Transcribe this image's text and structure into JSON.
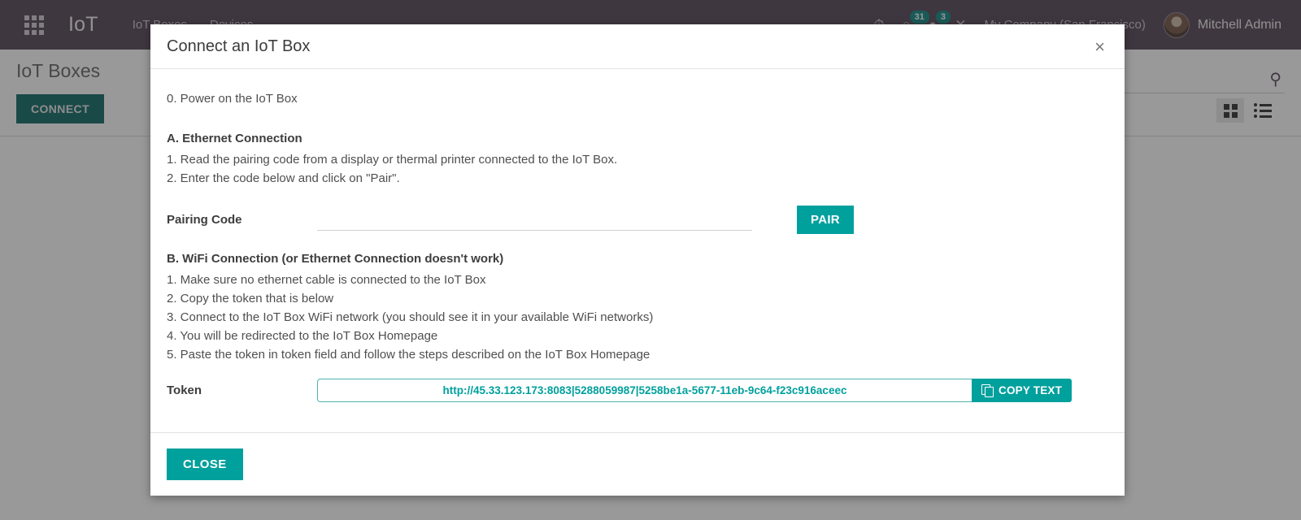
{
  "navbar": {
    "apps_icon": "apps-grid-icon",
    "brand": "IoT",
    "menu": [
      {
        "label": "IoT Boxes"
      },
      {
        "label": "Devices"
      }
    ],
    "activity_icon": "clock-icon",
    "calendar_icon": "calendar-icon",
    "calendar_count": "31",
    "messages_icon": "chat-icon",
    "messages_count": "3",
    "debug_icon": "bug-icon",
    "company": "My Company (San Francisco)",
    "user_name": "Mitchell Admin",
    "avatar": "user-avatar"
  },
  "control_panel": {
    "title": "IoT Boxes",
    "connect_label": "CONNECT",
    "search_icon": "search-icon",
    "search_placeholder": "",
    "kanban_icon": "kanban-view-icon",
    "list_icon": "list-view-icon"
  },
  "modal": {
    "title": "Connect an IoT Box",
    "close_icon": "×",
    "step0": "0. Power on the IoT Box",
    "section_a": {
      "heading": "A. Ethernet Connection",
      "lines": [
        "1. Read the pairing code from a display or thermal printer connected to the IoT Box.",
        "2. Enter the code below and click on \"Pair\"."
      ]
    },
    "pairing": {
      "label": "Pairing Code",
      "value": "",
      "placeholder": "",
      "button_label": "PAIR"
    },
    "section_b": {
      "heading": "B. WiFi Connection (or Ethernet Connection doesn't work)",
      "lines": [
        "1. Make sure no ethernet cable is connected to the IoT Box",
        "2. Copy the token that is below",
        "3. Connect to the IoT Box WiFi network (you should see it in your available WiFi networks)",
        "4. You will be redirected to the IoT Box Homepage",
        "5. Paste the token in token field and follow the steps described on the IoT Box Homepage"
      ]
    },
    "token": {
      "label": "Token",
      "value": "http://45.33.123.173:8083|5288059987|5258be1a-5677-11eb-9c64-f23c916aceec",
      "copy_label": "COPY TEXT",
      "copy_icon": "copy-icon"
    },
    "footer": {
      "close_label": "CLOSE"
    }
  },
  "colors": {
    "navbar": "#4a3b4d",
    "accent_teal": "#00A09D",
    "connect_teal": "#00605d",
    "badge": "#00807c"
  }
}
